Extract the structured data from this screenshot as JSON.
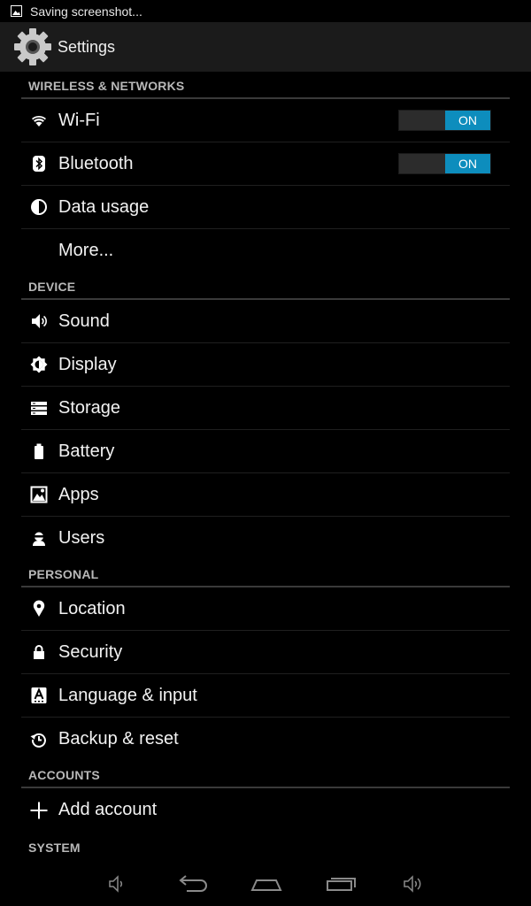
{
  "status_bar": {
    "notification_text": "Saving screenshot...",
    "icon": "screenshot-icon"
  },
  "action_bar": {
    "title": "Settings",
    "icon": "settings-gear-icon"
  },
  "sections": {
    "wireless": {
      "header": "WIRELESS & NETWORKS",
      "items": [
        {
          "label": "Wi-Fi",
          "icon": "wifi-icon",
          "toggle": "ON"
        },
        {
          "label": "Bluetooth",
          "icon": "bluetooth-icon",
          "toggle": "ON"
        },
        {
          "label": "Data usage",
          "icon": "data-usage-icon"
        },
        {
          "label": "More..."
        }
      ]
    },
    "device": {
      "header": "DEVICE",
      "items": [
        {
          "label": "Sound",
          "icon": "sound-icon"
        },
        {
          "label": "Display",
          "icon": "display-icon"
        },
        {
          "label": "Storage",
          "icon": "storage-icon"
        },
        {
          "label": "Battery",
          "icon": "battery-icon"
        },
        {
          "label": "Apps",
          "icon": "apps-icon"
        },
        {
          "label": "Users",
          "icon": "users-icon"
        }
      ]
    },
    "personal": {
      "header": "PERSONAL",
      "items": [
        {
          "label": "Location",
          "icon": "location-icon"
        },
        {
          "label": "Security",
          "icon": "lock-icon"
        },
        {
          "label": "Language & input",
          "icon": "language-icon"
        },
        {
          "label": "Backup & reset",
          "icon": "backup-icon"
        }
      ]
    },
    "accounts": {
      "header": "ACCOUNTS",
      "items": [
        {
          "label": "Add account",
          "icon": "plus-icon"
        }
      ]
    },
    "system": {
      "header": "SYSTEM"
    }
  },
  "nav_bar": {
    "buttons": [
      "volume-down-icon",
      "back-icon",
      "home-icon",
      "recent-apps-icon",
      "volume-up-icon"
    ]
  },
  "colors": {
    "accent": "#0d8dbd",
    "background": "#000000",
    "action_bar": "#1b1b1b",
    "divider": "#3a3a3a"
  }
}
